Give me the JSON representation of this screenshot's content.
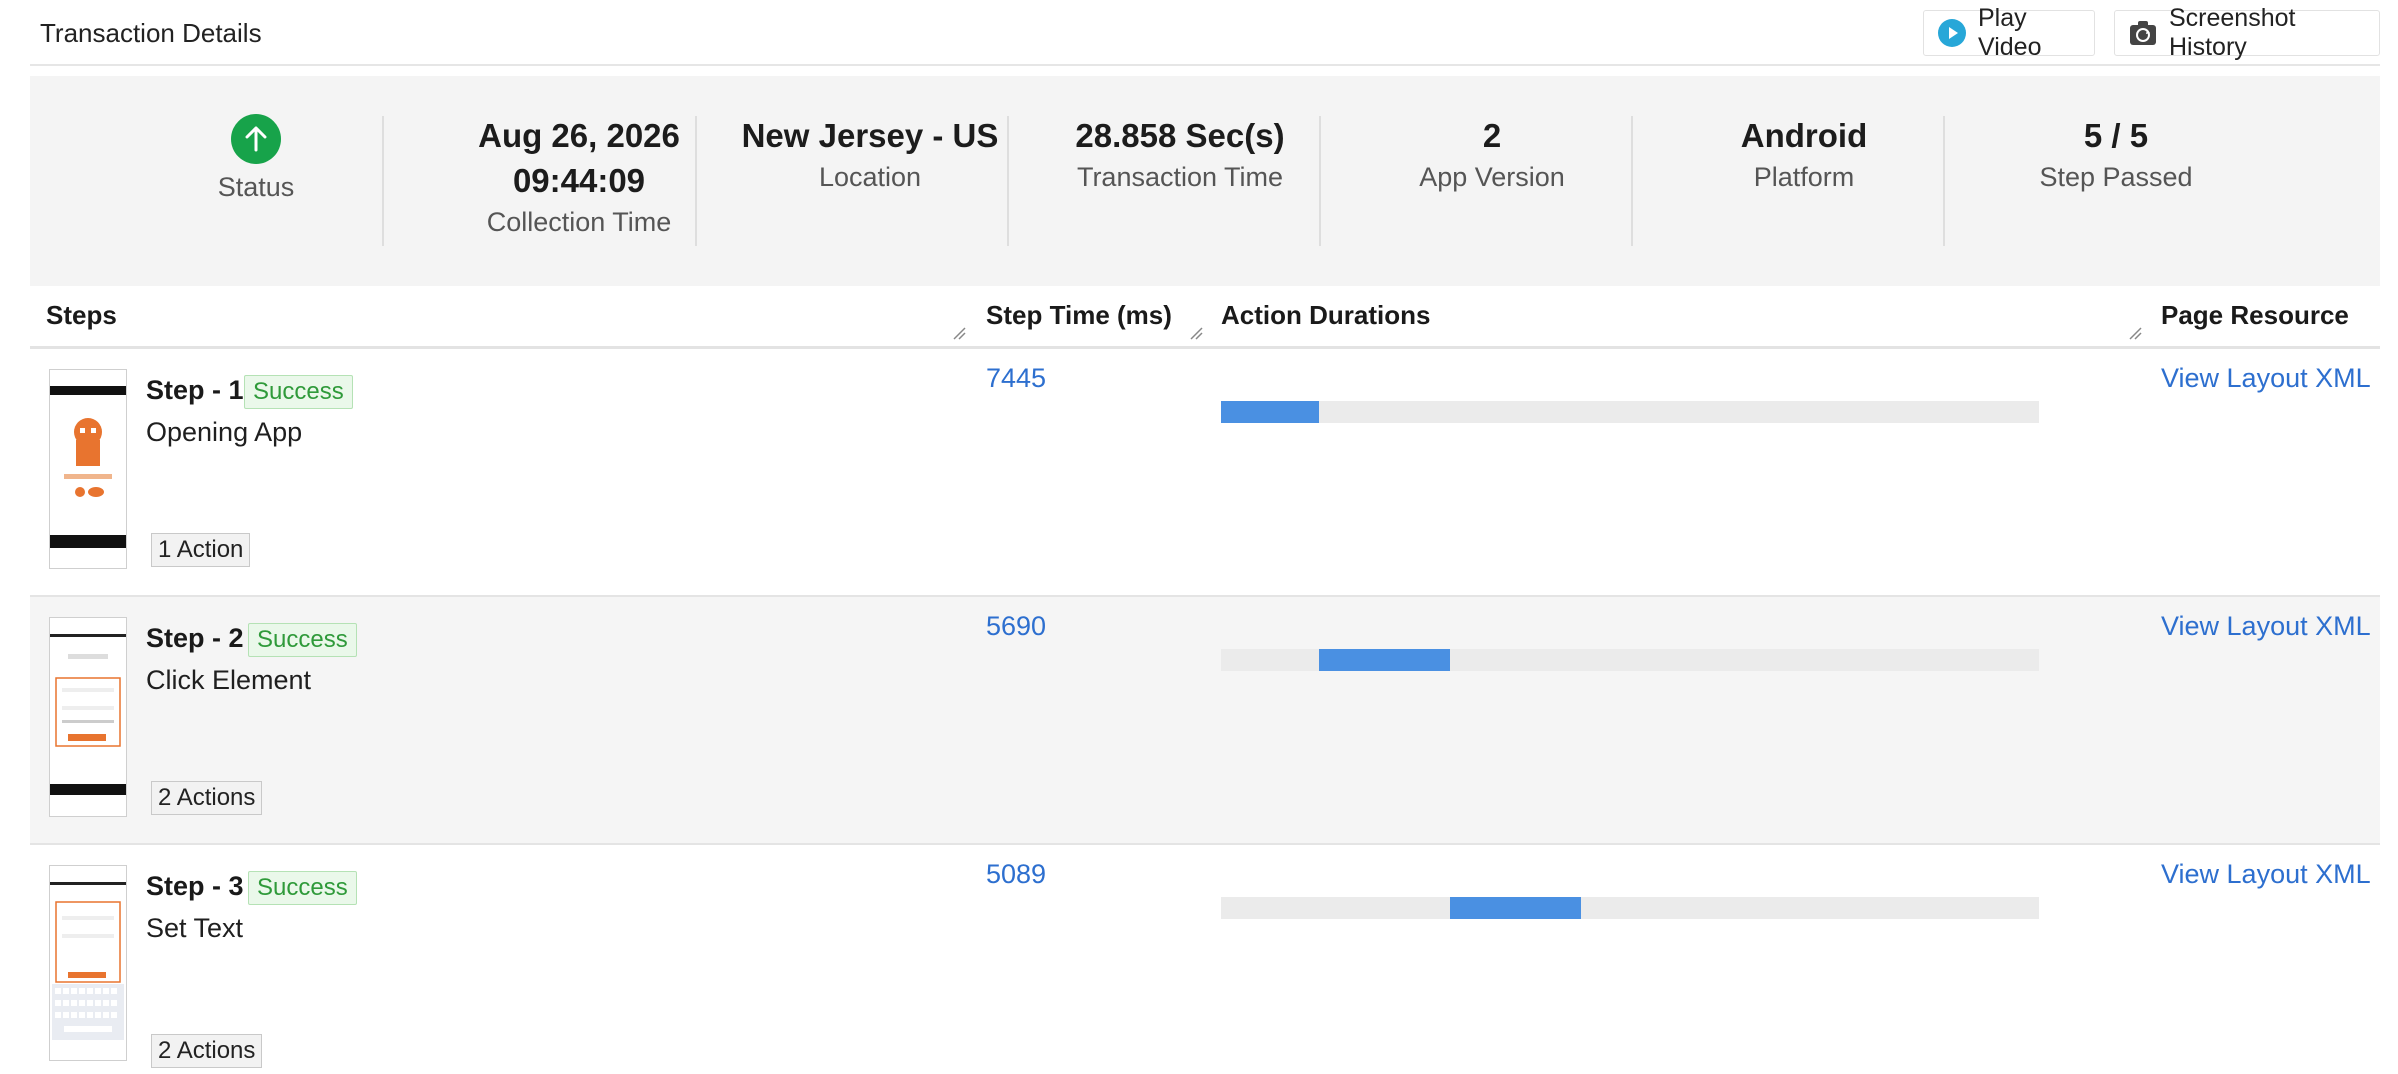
{
  "header": {
    "title": "Transaction Details",
    "play_video": "Play Video",
    "screenshot_history": "Screenshot History"
  },
  "summary": {
    "status_label": "Status",
    "collection_date": "Aug 26, 2026",
    "collection_time": "09:44:09",
    "collection_label": "Collection Time",
    "location": "New Jersey - US",
    "location_label": "Location",
    "transaction_time": "28.858 Sec(s)",
    "transaction_label": "Transaction Time",
    "app_version": "2",
    "app_version_label": "App Version",
    "platform": "Android",
    "platform_label": "Platform",
    "steps_passed": "5 / 5",
    "steps_passed_label": "Step Passed"
  },
  "table": {
    "headers": [
      "Steps",
      "Step Time (ms)",
      "Action Durations",
      "Page Resource"
    ],
    "rows": [
      {
        "name": "Step - 1",
        "status": "Success",
        "desc": "Opening App",
        "actions": "1 Action",
        "time": "7445",
        "link": "View Layout XML",
        "bar_start": 0.0,
        "bar_end": 0.12
      },
      {
        "name": "Step - 2",
        "status": "Success",
        "desc": "Click Element",
        "actions": "2 Actions",
        "time": "5690",
        "link": "View Layout XML",
        "bar_start": 0.12,
        "bar_end": 0.28
      },
      {
        "name": "Step - 3",
        "status": "Success",
        "desc": "Set Text",
        "actions": "2 Actions",
        "time": "5089",
        "link": "View Layout XML",
        "bar_start": 0.28,
        "bar_end": 0.44
      }
    ]
  },
  "colors": {
    "accent": "#2d6fcf",
    "success": "#17a34a",
    "bar": "#4a90e2"
  }
}
